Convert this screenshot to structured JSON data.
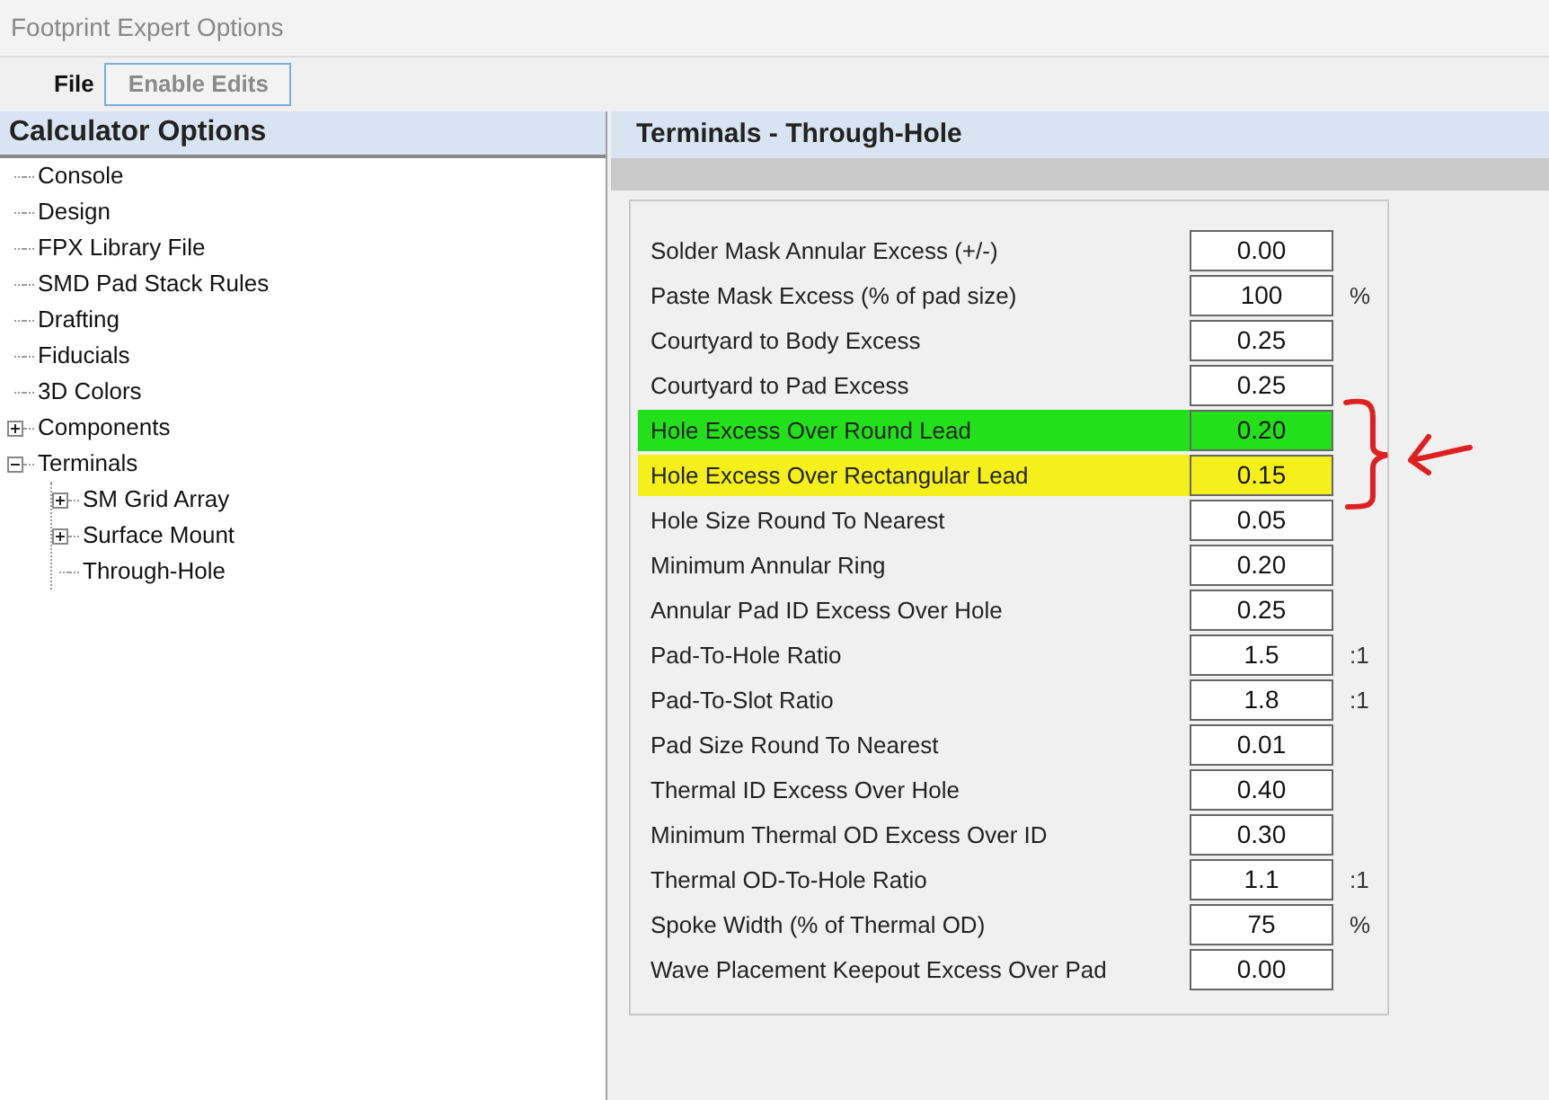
{
  "window": {
    "title": "Footprint Expert Options"
  },
  "menu": [
    {
      "label": "File",
      "kind": "menu"
    },
    {
      "label": "Enable Edits",
      "kind": "button"
    }
  ],
  "sidebar": {
    "title": "Calculator Options",
    "items": [
      {
        "label": "Console",
        "kind": "leaf"
      },
      {
        "label": "Design",
        "kind": "leaf"
      },
      {
        "label": "FPX Library File",
        "kind": "leaf"
      },
      {
        "label": "SMD Pad Stack Rules",
        "kind": "leaf"
      },
      {
        "label": "Drafting",
        "kind": "leaf"
      },
      {
        "label": "Fiducials",
        "kind": "leaf"
      },
      {
        "label": "3D Colors",
        "kind": "leaf"
      },
      {
        "label": "Components",
        "kind": "node",
        "expanded": false
      },
      {
        "label": "Terminals",
        "kind": "node",
        "expanded": true,
        "children": [
          {
            "label": "SM Grid Array",
            "kind": "node",
            "expanded": false
          },
          {
            "label": "Surface Mount",
            "kind": "node",
            "expanded": false
          },
          {
            "label": "Through-Hole",
            "kind": "leaf"
          }
        ]
      }
    ]
  },
  "panel": {
    "title": "Terminals - Through-Hole",
    "rows": [
      {
        "label": "Solder Mask Annular Excess (+/-)",
        "value": "0.00"
      },
      {
        "label": "Paste Mask Excess (% of pad size)",
        "value": "100",
        "unit": "%"
      },
      {
        "label": "Courtyard to Body Excess",
        "value": "0.25"
      },
      {
        "label": "Courtyard to Pad Excess",
        "value": "0.25"
      },
      {
        "label": "Hole Excess Over Round Lead",
        "value": "0.20",
        "color": "#22e01a"
      },
      {
        "label": "Hole Excess Over Rectangular Lead",
        "value": "0.15",
        "color": "#f5f01a"
      },
      {
        "label": "Hole Size Round To Nearest",
        "value": "0.05"
      },
      {
        "label": "Minimum Annular Ring",
        "value": "0.20"
      },
      {
        "label": "Annular Pad ID Excess Over Hole",
        "value": "0.25"
      },
      {
        "label": "Pad-To-Hole Ratio",
        "value": "1.5",
        "unit": ":1"
      },
      {
        "label": "Pad-To-Slot Ratio",
        "value": "1.8",
        "unit": ":1"
      },
      {
        "label": "Pad Size Round To Nearest",
        "value": "0.01"
      },
      {
        "label": "Thermal ID Excess Over Hole",
        "value": "0.40"
      },
      {
        "label": "Minimum Thermal OD Excess Over ID",
        "value": "0.30"
      },
      {
        "label": "Thermal OD-To-Hole Ratio",
        "value": "1.1",
        "unit": ":1"
      },
      {
        "label": "Spoke Width (% of Thermal OD)",
        "value": "75",
        "unit": "%"
      },
      {
        "label": "Wave Placement Keepout Excess Over Pad",
        "value": "0.00"
      }
    ]
  }
}
